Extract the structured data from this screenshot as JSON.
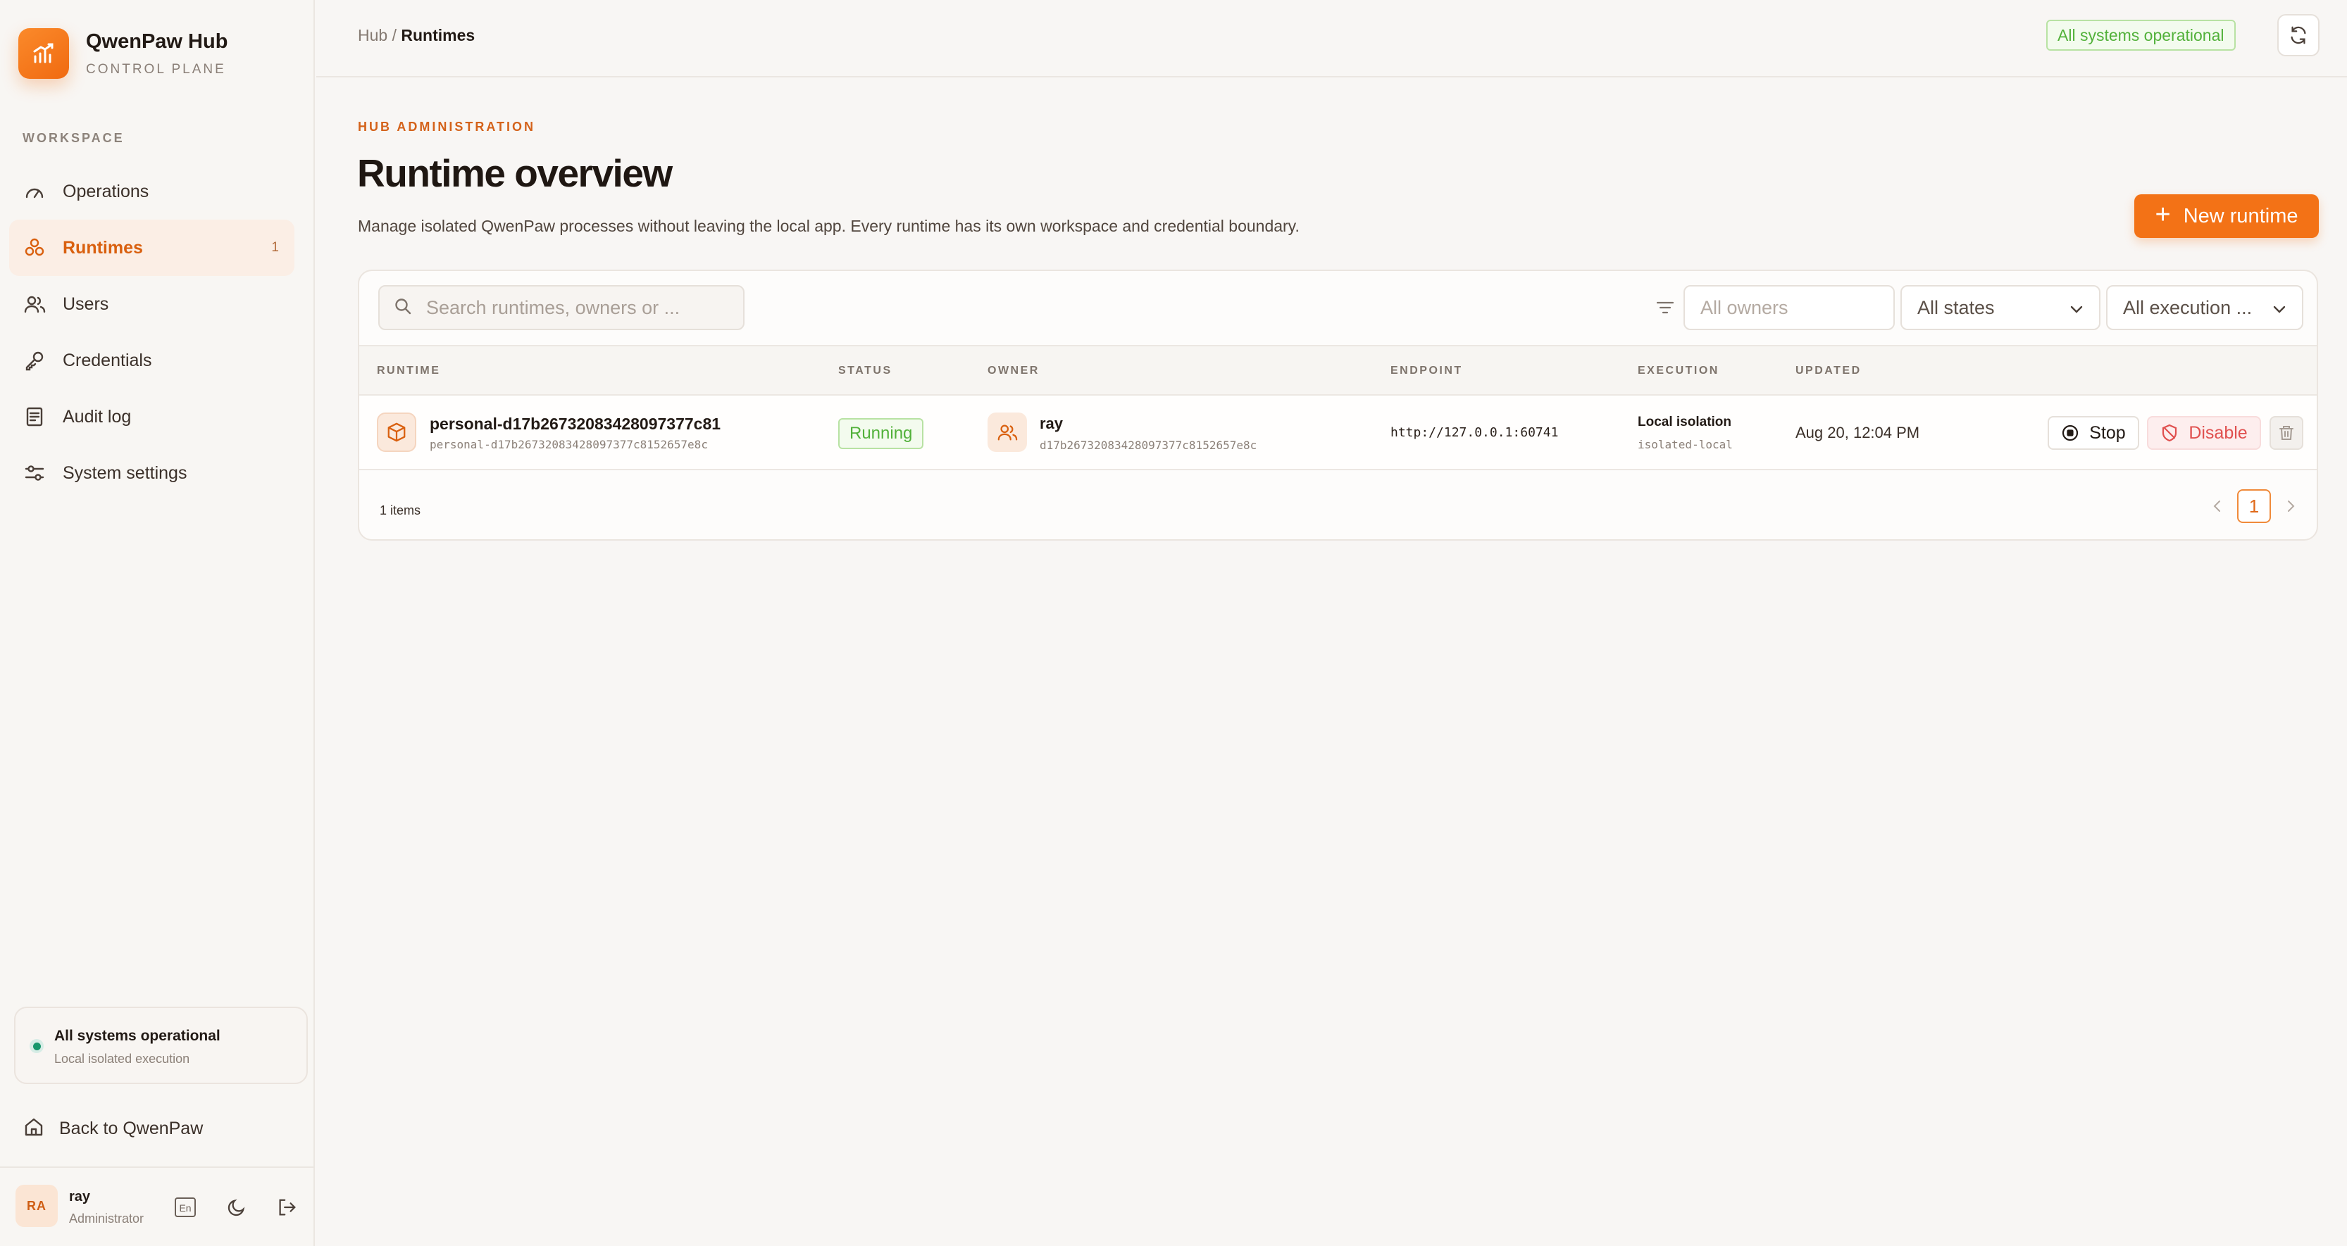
{
  "brand": {
    "title": "QwenPaw Hub",
    "subtitle": "CONTROL PLANE",
    "accent": "#f37216"
  },
  "sidebar": {
    "section_label": "WORKSPACE",
    "items": [
      {
        "label": "Operations",
        "icon": "gauge-icon"
      },
      {
        "label": "Runtimes",
        "icon": "cluster-icon",
        "badge": "1",
        "active": true
      },
      {
        "label": "Users",
        "icon": "users-icon"
      },
      {
        "label": "Credentials",
        "icon": "key-icon"
      },
      {
        "label": "Audit log",
        "icon": "log-icon"
      },
      {
        "label": "System settings",
        "icon": "sliders-icon"
      }
    ],
    "status": {
      "title": "All systems operational",
      "subtitle": "Local isolated execution",
      "color": "#17966b"
    },
    "back_label": "Back to QwenPaw",
    "user": {
      "initials": "RA",
      "name": "ray",
      "role": "Administrator",
      "lang": "En"
    }
  },
  "topbar": {
    "breadcrumb_root": "Hub",
    "breadcrumb_sep": " / ",
    "breadcrumb_current": "Runtimes",
    "health": "All systems operational"
  },
  "main": {
    "eyebrow": "HUB ADMINISTRATION",
    "title": "Runtime overview",
    "description": "Manage isolated QwenPaw processes without leaving the local app. Every runtime has its own workspace and credential boundary.",
    "new_button": "New runtime",
    "filters": {
      "search_placeholder": "Search runtimes, owners or ...",
      "owners_placeholder": "All owners",
      "states": "All states",
      "execution": "All execution ..."
    },
    "columns": [
      "RUNTIME",
      "STATUS",
      "OWNER",
      "ENDPOINT",
      "EXECUTION",
      "UPDATED"
    ],
    "rows": [
      {
        "name": "personal-d17b26732083428097377c81",
        "id": "personal-d17b26732083428097377c8152657e8c",
        "status": "Running",
        "owner": "ray",
        "owner_id": "d17b26732083428097377c8152657e8c",
        "endpoint": "http://127.0.0.1:60741",
        "execution": "Local isolation",
        "execution_sub": "isolated-local",
        "updated": "Aug 20, 12:04 PM",
        "actions": {
          "stop": "Stop",
          "disable": "Disable"
        }
      }
    ],
    "footer": {
      "count": "1 items",
      "page": "1"
    }
  }
}
